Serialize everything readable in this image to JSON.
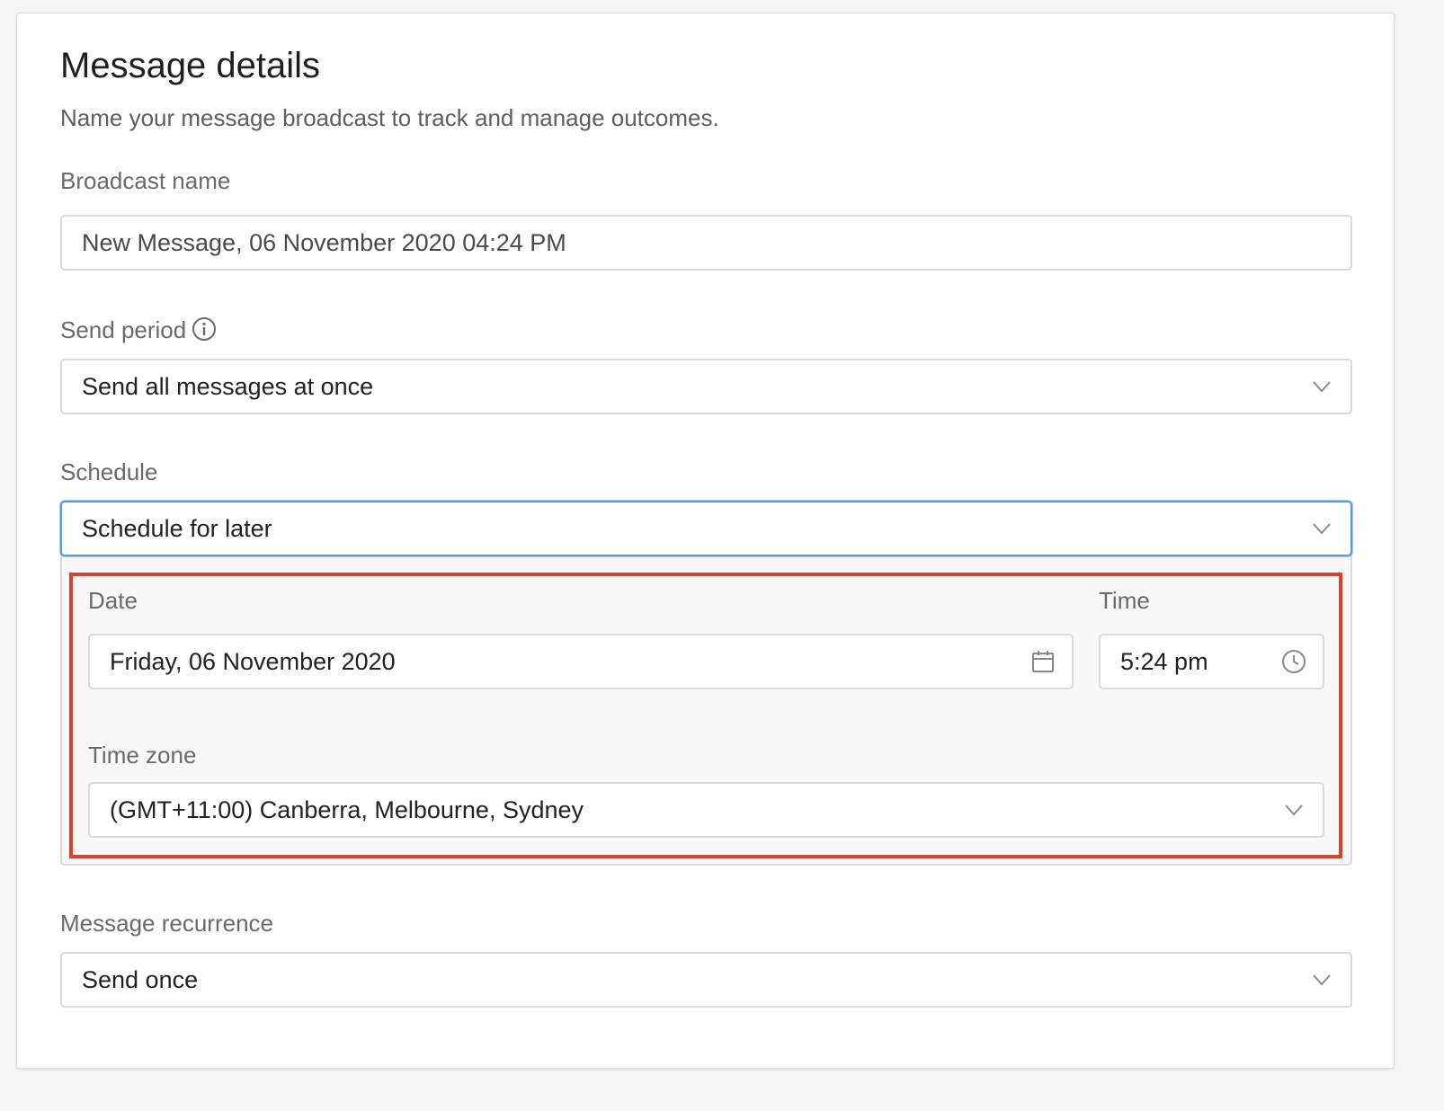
{
  "header": {
    "title": "Message details",
    "subtitle": "Name your message broadcast to track and manage outcomes."
  },
  "broadcast_name": {
    "label": "Broadcast name",
    "value": "New Message, 06 November 2020 04:24 PM"
  },
  "send_period": {
    "label": "Send period",
    "selected": "Send all messages at once"
  },
  "schedule": {
    "label": "Schedule",
    "selected": "Schedule for later",
    "date": {
      "label": "Date",
      "value": "Friday, 06 November 2020"
    },
    "time": {
      "label": "Time",
      "value": "5:24 pm"
    },
    "time_zone": {
      "label": "Time zone",
      "selected": "(GMT+11:00) Canberra, Melbourne, Sydney"
    }
  },
  "message_recurrence": {
    "label": "Message recurrence",
    "selected": "Send once"
  },
  "colors": {
    "highlight_border": "#e0402a",
    "focus_border": "#5b9bd5"
  },
  "icons": [
    "info-icon",
    "chevron-down-icon",
    "calendar-icon",
    "clock-icon"
  ]
}
